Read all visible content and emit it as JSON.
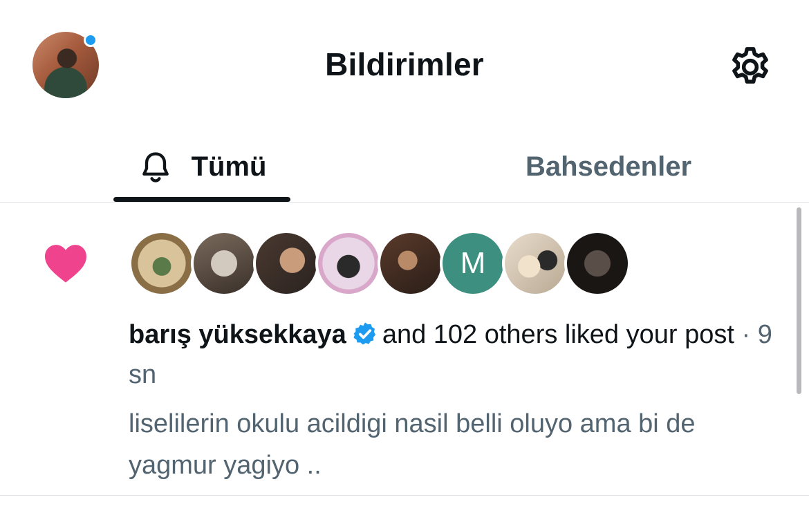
{
  "header": {
    "title": "Bildirimler",
    "avatar_icon": "user-avatar",
    "settings_icon": "gear-icon"
  },
  "tabs": [
    {
      "label": "Tümü",
      "icon": "bell-icon",
      "active": true
    },
    {
      "label": "Bahsedenler",
      "active": false
    }
  ],
  "notification": {
    "type_icon": "heart-icon",
    "liker_avatars": [
      {
        "name": "avatar-1"
      },
      {
        "name": "avatar-2"
      },
      {
        "name": "avatar-3"
      },
      {
        "name": "avatar-4"
      },
      {
        "name": "avatar-5"
      },
      {
        "name": "avatar-6",
        "initial": "M"
      },
      {
        "name": "avatar-7"
      },
      {
        "name": "avatar-8"
      }
    ],
    "username": "barış yüksekkaya",
    "verified_icon": "verified-badge-icon",
    "action_text": "and 102 others liked your post",
    "separator": "·",
    "time": "9 sn",
    "post_snippet": "liselilerin okulu acildigi nasil belli oluyo ama bi de yagmur yagiyo .."
  },
  "colors": {
    "accent": "#1d9bf0",
    "heart": "#f91880",
    "text_primary": "#0f1419",
    "text_secondary": "#536471",
    "avatar_m_bg": "#3d8f80"
  }
}
